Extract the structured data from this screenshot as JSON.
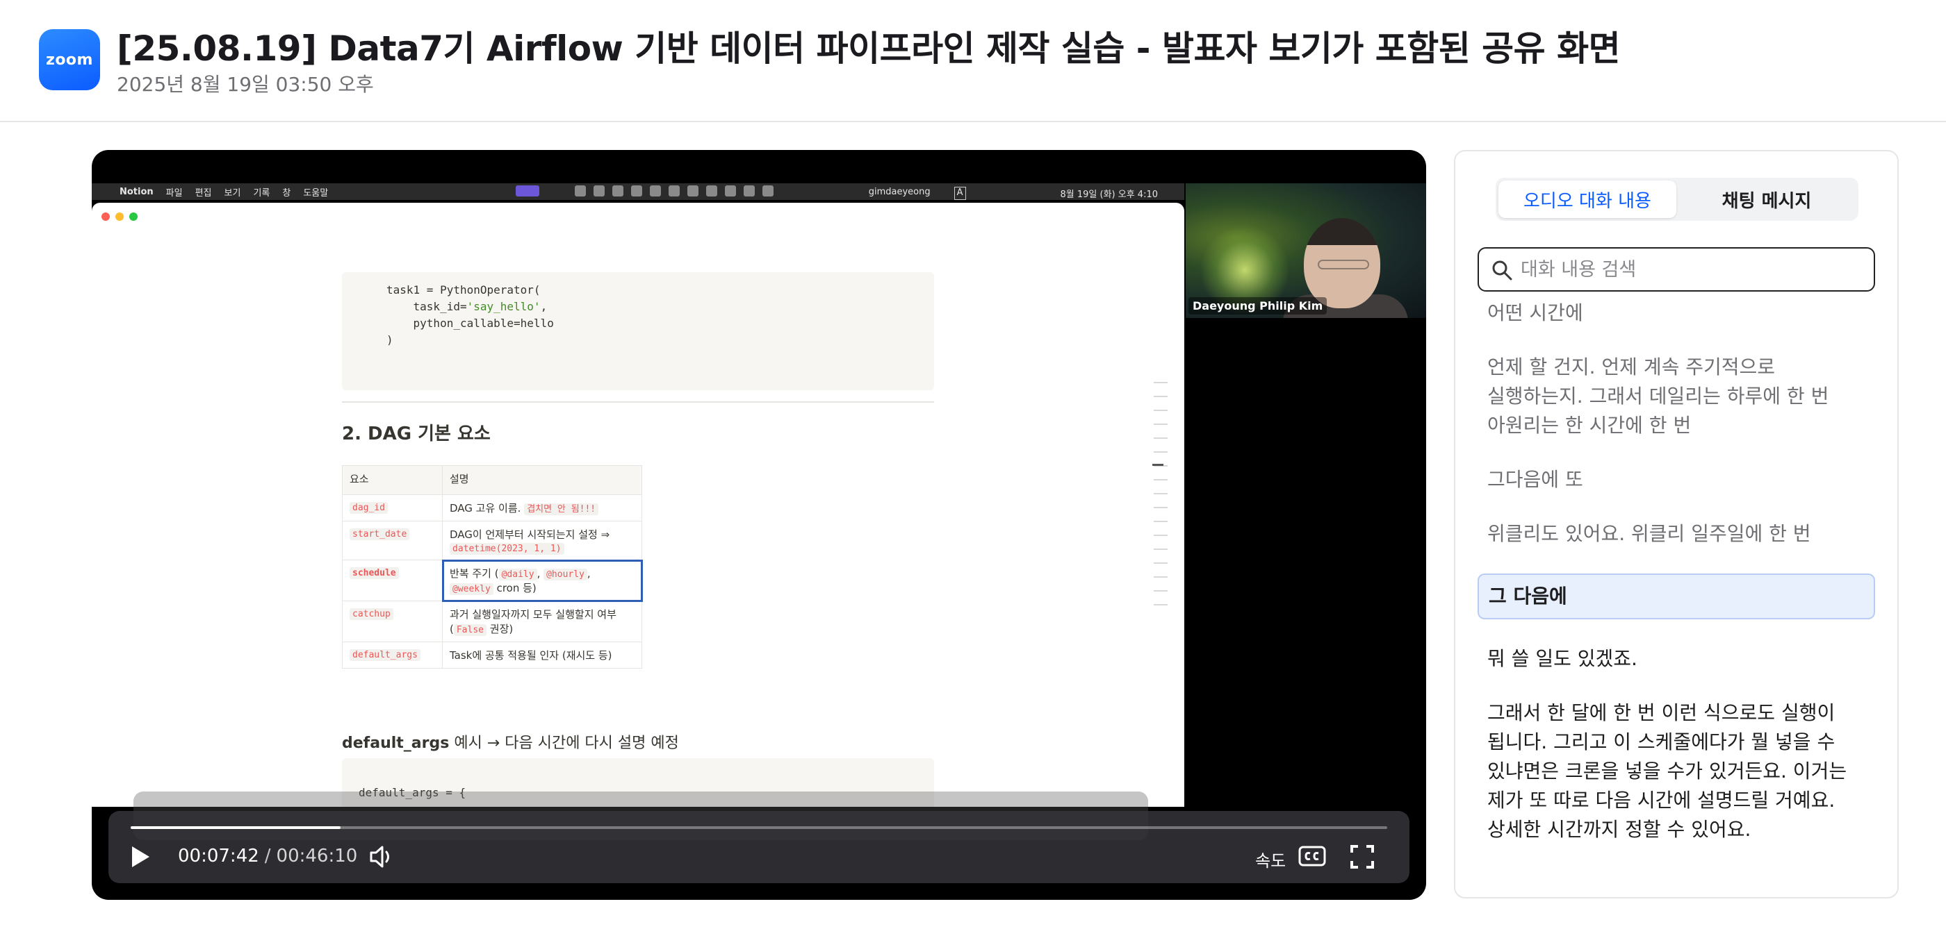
{
  "header": {
    "logo_text": "zoom",
    "title": "[25.08.19] Data7기 Airflow 기반 데이터 파이프라인 제작 실습 - 발표자 보기가 포함된 공유 화면",
    "subtitle": "2025년 8월 19일 03:50 오후"
  },
  "shared_screen": {
    "menubar": {
      "app": "Notion",
      "items": [
        "파일",
        "편집",
        "보기",
        "기록",
        "창",
        "도움말"
      ],
      "user": "gimdaeyeong",
      "input_mode": "A",
      "clock": "8월 19일 (화) 오후 4:10"
    },
    "code_top": {
      "line1": "task1 = PythonOperator(",
      "line2_key": "    task_id=",
      "line2_val": "'say_hello'",
      "line2_end": ",",
      "line3": "    python_callable=hello",
      "line4": ")"
    },
    "section_heading": "2. DAG 기본 요소",
    "table": {
      "headers": [
        "요소",
        "설명"
      ],
      "rows": [
        {
          "key": "dag_id",
          "desc": "DAG 고유 이름.",
          "code": "겹치면 안 됨!!!"
        },
        {
          "key": "start_date",
          "desc": "DAG이 언제부터 시작되는지 설정 ⇒",
          "code": "datetime(2023, 1, 1)"
        },
        {
          "key": "schedule",
          "desc": "반복 주기 (",
          "c1": "@daily",
          "c2": "@hourly",
          "c3": "@weekly",
          "tail": "cron 등)"
        },
        {
          "key": "catchup",
          "desc": "과거 실행일자까지 모두 실행할지 여부 (",
          "code": "False",
          "tail": " 권장)"
        },
        {
          "key": "default_args",
          "desc": "Task에 공통 적용될 인자 (재시도 등)"
        }
      ]
    },
    "default_heading_bold": "default_args",
    "default_heading_rest": " 예시 → 다음 시간에 다시 설명 예정",
    "code_bottom": "default_args = {"
  },
  "webcam": {
    "name": "Daeyoung Philip Kim"
  },
  "player": {
    "current_time": "00:07:42",
    "separator": "/",
    "duration": "00:46:10",
    "progress_fraction": 0.1668,
    "speed_label": "속도"
  },
  "panel": {
    "tabs": [
      "오디오 대화 내용",
      "채팅 메시지"
    ],
    "active_tab": 0,
    "search_placeholder": "대화 내용 검색",
    "transcript": [
      {
        "text": "어떤 시간에",
        "state": "past"
      },
      {
        "text": "언제 할 건지. 언제 계속 주기적으로 실행하는지. 그래서 데일리는 하루에 한 번 아원리는 한 시간에 한 번",
        "state": "past"
      },
      {
        "text": "그다음에 또",
        "state": "past"
      },
      {
        "text": "위클리도 있어요. 위클리 일주일에 한 번",
        "state": "past"
      },
      {
        "text": "그 다음에",
        "state": "active"
      },
      {
        "text": "뭐 쓸 일도 있겠죠.",
        "state": "future"
      },
      {
        "text": "그래서 한 달에 한 번 이런 식으로도 실행이 됩니다. 그리고 이 스케줄에다가 뭘 넣을 수 있냐면은 크론을 넣을 수가 있거든요. 이거는 제가 또 따로 다음 시간에 설명드릴 거예요. 상세한 시간까지 정할 수 있어요.",
        "state": "future"
      }
    ]
  },
  "colors": {
    "accent": "#0b5cff",
    "active_segment_bg": "#e8f0fd",
    "code_red": "#eb5757"
  }
}
